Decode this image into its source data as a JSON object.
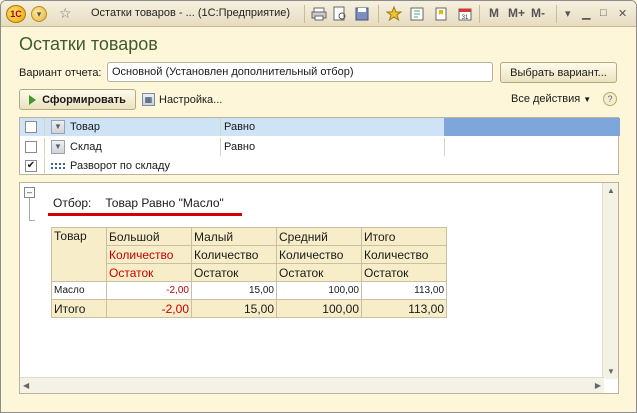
{
  "window": {
    "title": "Остатки товаров - ... (1С:Предприятие)",
    "m_buttons": [
      "M",
      "M+",
      "M-"
    ]
  },
  "form": {
    "title": "Остатки товаров",
    "variant_label": "Вариант отчета:",
    "variant_value": "Основной (Установлен дополнительный отбор)",
    "choose_variant_button": "Выбрать вариант...",
    "generate_button": "Сформировать",
    "settings_link": "Настройка...",
    "all_actions": "Все действия",
    "help": "?"
  },
  "settings_rows": [
    {
      "checked": false,
      "name": "Товар",
      "condition": "Равно"
    },
    {
      "checked": false,
      "name": "Склад",
      "condition": "Равно"
    },
    {
      "checked": true,
      "name": "Разворот по складу",
      "condition": ""
    }
  ],
  "report": {
    "filter_label": "Отбор:",
    "filter_value": "Товар Равно \"Масло\"",
    "col_product": "Товар",
    "warehouses": [
      "Большой",
      "Малый",
      "Средний",
      "Итого"
    ],
    "measure_1": "Количество",
    "measure_2": "Остаток",
    "rows": [
      {
        "name": "Масло",
        "values": [
          "-2,00",
          "15,00",
          "100,00",
          "113,00"
        ]
      }
    ],
    "total": {
      "name": "Итого",
      "values": [
        "-2,00",
        "15,00",
        "100,00",
        "113,00"
      ]
    }
  },
  "colors": {
    "accent_title": "#3f5b2e",
    "negative": "#c80000",
    "selection": "#cfe3f7"
  }
}
